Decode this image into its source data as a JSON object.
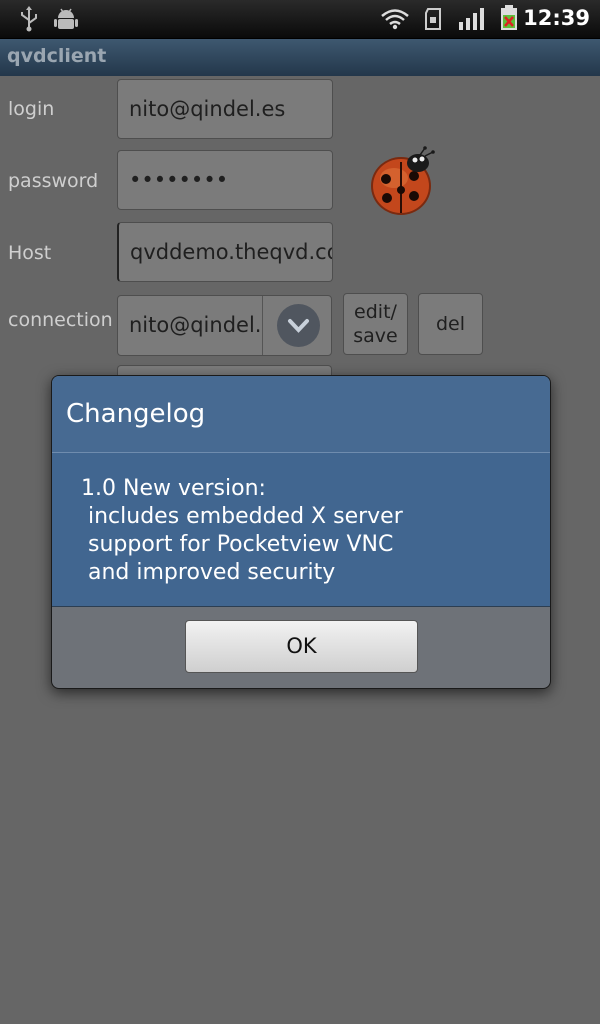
{
  "status_bar": {
    "time": "12:39",
    "icons": [
      "usb-icon",
      "android-debug-icon",
      "wifi-icon",
      "sd-card-icon",
      "signal-icon",
      "battery-icon"
    ]
  },
  "app": {
    "title": "qvdclient"
  },
  "form": {
    "login_label": "login",
    "login_value": "nito@qindel.es",
    "password_label": "password",
    "password_value": "••••••••",
    "host_label": "Host",
    "host_value": "qvddemo.theqvd.com",
    "connection_label": "connection",
    "connection_value": "nito@qindel.es",
    "edit_save_label_1": "edit/",
    "edit_save_label_2": "save",
    "del_label": "del"
  },
  "dialog": {
    "title": "Changelog",
    "lines": [
      "1.0 New version:",
      " includes embedded X server",
      " support for Pocketview VNC",
      " and improved security"
    ],
    "ok_label": "OK"
  },
  "colors": {
    "background": "#666666",
    "title_bar": "#2f475e",
    "dialog_header": "#476a92",
    "dialog_body": "#416690"
  }
}
